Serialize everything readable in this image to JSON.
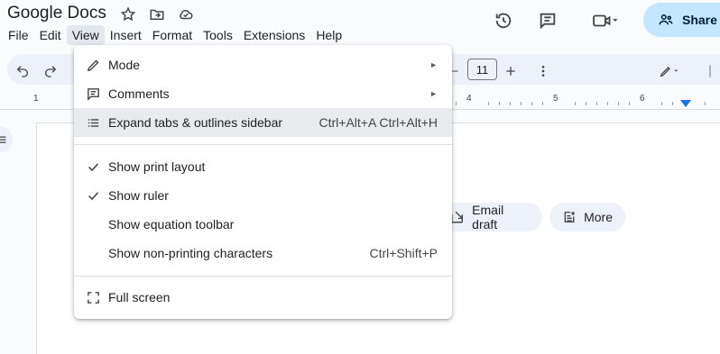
{
  "app": {
    "title": "Google Docs"
  },
  "menubar": {
    "items": [
      "File",
      "Edit",
      "View",
      "Insert",
      "Format",
      "Tools",
      "Extensions",
      "Help"
    ],
    "active": "View"
  },
  "header": {
    "share_label": "Share"
  },
  "toolbar": {
    "font_size": "11"
  },
  "ruler": {
    "numbers": [
      "1",
      "4",
      "5",
      "6"
    ]
  },
  "chips": {
    "email_draft": "Email draft",
    "more": "More"
  },
  "view_menu": {
    "items": [
      {
        "label": "Mode",
        "icon": "pencil-icon",
        "submenu": true
      },
      {
        "label": "Comments",
        "icon": "comment-icon",
        "submenu": true
      },
      {
        "label": "Expand tabs & outlines sidebar",
        "icon": "list-icon",
        "shortcut": "Ctrl+Alt+A Ctrl+Alt+H",
        "highlighted": true
      },
      {
        "label": "Show print layout",
        "icon": "check-icon",
        "checked": true
      },
      {
        "label": "Show ruler",
        "icon": "check-icon",
        "checked": true
      },
      {
        "label": "Show equation toolbar"
      },
      {
        "label": "Show non-printing characters",
        "shortcut": "Ctrl+Shift+P"
      },
      {
        "label": "Full screen",
        "icon": "fullscreen-icon"
      }
    ]
  },
  "colors": {
    "share_bg": "#c2e7ff",
    "accent": "#1a73e8",
    "menu_highlight": "#e8eaed"
  }
}
